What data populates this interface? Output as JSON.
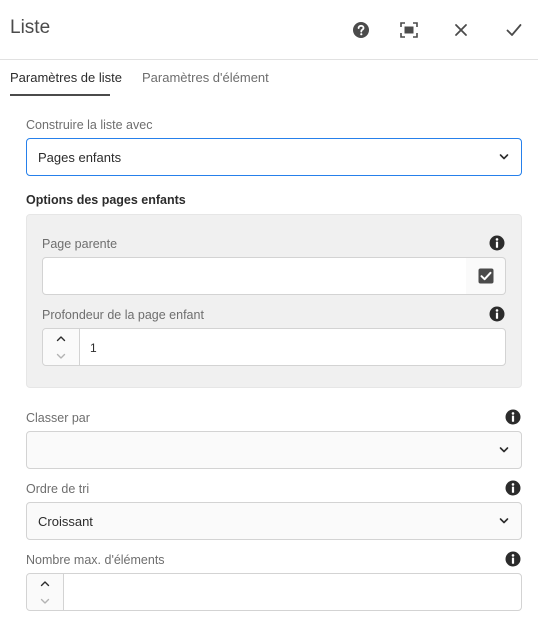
{
  "header": {
    "title": "Liste",
    "buttons": [
      "help-icon",
      "fullscreen-icon",
      "close-icon",
      "done-icon"
    ]
  },
  "tabs": [
    {
      "label": "Paramètres de liste",
      "active": true
    },
    {
      "label": "Paramètres d'élément",
      "active": false
    }
  ],
  "build_list": {
    "label": "Construire la liste avec",
    "value": "Pages enfants"
  },
  "child_pages": {
    "section_title": "Options des pages enfants",
    "parent_page": {
      "label": "Page parente",
      "value": ""
    },
    "depth": {
      "label": "Profondeur de la page enfant",
      "value": "1"
    }
  },
  "order_by": {
    "label": "Classer par",
    "value": ""
  },
  "sort_order": {
    "label": "Ordre de tri",
    "value": "Croissant"
  },
  "max_items": {
    "label": "Nombre max. d'éléments",
    "value": ""
  },
  "colors": {
    "accent": "#2680eb",
    "text": "#4b4b4b",
    "panel": "#f0f0f0"
  }
}
